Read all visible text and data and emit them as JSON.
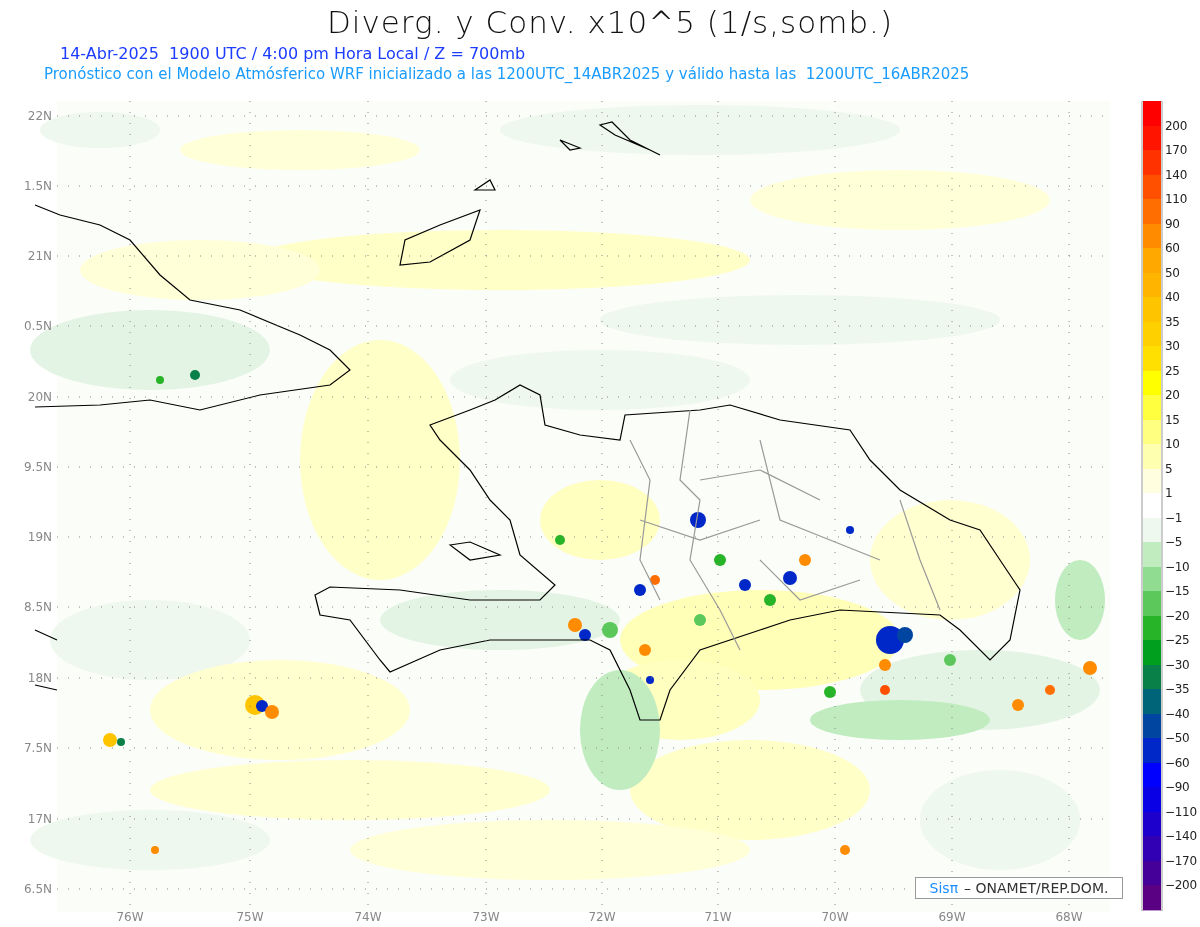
{
  "title": "Diverg. y Conv. x10^5 (1/s,somb.)",
  "subtitle": "14-Abr-2025  1900 UTC / 4:00 pm Hora Local / Z = 700mb",
  "forecast_note": "Pronóstico con el Modelo Atmósferico WRF inicializado a las 1200UTC_14ABR2025 y válido hasta las  1200UTC_16ABR2025",
  "map": {
    "y_labels": [
      "22N",
      "1.5N",
      "21N",
      "0.5N",
      "20N",
      "9.5N",
      "19N",
      "8.5N",
      "18N",
      "7.5N",
      "17N",
      "6.5N"
    ],
    "x_labels": [
      "76W",
      "75W",
      "74W",
      "73W",
      "72W",
      "71W",
      "70W",
      "69W",
      "68W"
    ],
    "credit": {
      "logo": "Sisπ",
      "text": "– ONAMET/REP.DOM."
    }
  },
  "colorbar": {
    "swatches": [
      {
        "color": "#ff0000",
        "label": "200"
      },
      {
        "color": "#ff1400",
        "label": "170"
      },
      {
        "color": "#ff3200",
        "label": "140"
      },
      {
        "color": "#ff5000",
        "label": "110"
      },
      {
        "color": "#ff6e00",
        "label": "90"
      },
      {
        "color": "#ff8c00",
        "label": "60"
      },
      {
        "color": "#ffa800",
        "label": "50"
      },
      {
        "color": "#ffb400",
        "label": "40"
      },
      {
        "color": "#ffc400",
        "label": "35"
      },
      {
        "color": "#ffd000",
        "label": "30"
      },
      {
        "color": "#ffe000",
        "label": "25"
      },
      {
        "color": "#ffff00",
        "label": "20"
      },
      {
        "color": "#ffff40",
        "label": "15"
      },
      {
        "color": "#ffff80",
        "label": "10"
      },
      {
        "color": "#ffffb0",
        "label": "5"
      },
      {
        "color": "#ffffe0",
        "label": "1"
      },
      {
        "color": "#ffffff",
        "label": "−1"
      },
      {
        "color": "#eef8ee",
        "label": "−5"
      },
      {
        "color": "#c0ecc0",
        "label": "−10"
      },
      {
        "color": "#90dc90",
        "label": "−15"
      },
      {
        "color": "#5cc85c",
        "label": "−20"
      },
      {
        "color": "#28b428",
        "label": "−25"
      },
      {
        "color": "#00a01e",
        "label": "−30"
      },
      {
        "color": "#088048",
        "label": "−35"
      },
      {
        "color": "#006478",
        "label": "−40"
      },
      {
        "color": "#0046a0",
        "label": "−50"
      },
      {
        "color": "#0028c8",
        "label": "−60"
      },
      {
        "color": "#0000ff",
        "label": "−90"
      },
      {
        "color": "#0a00e6",
        "label": "−110"
      },
      {
        "color": "#1e00cc",
        "label": "−140"
      },
      {
        "color": "#3200b4",
        "label": "−170"
      },
      {
        "color": "#46009a",
        "label": "−200"
      },
      {
        "color": "#5a0082"
      }
    ]
  }
}
